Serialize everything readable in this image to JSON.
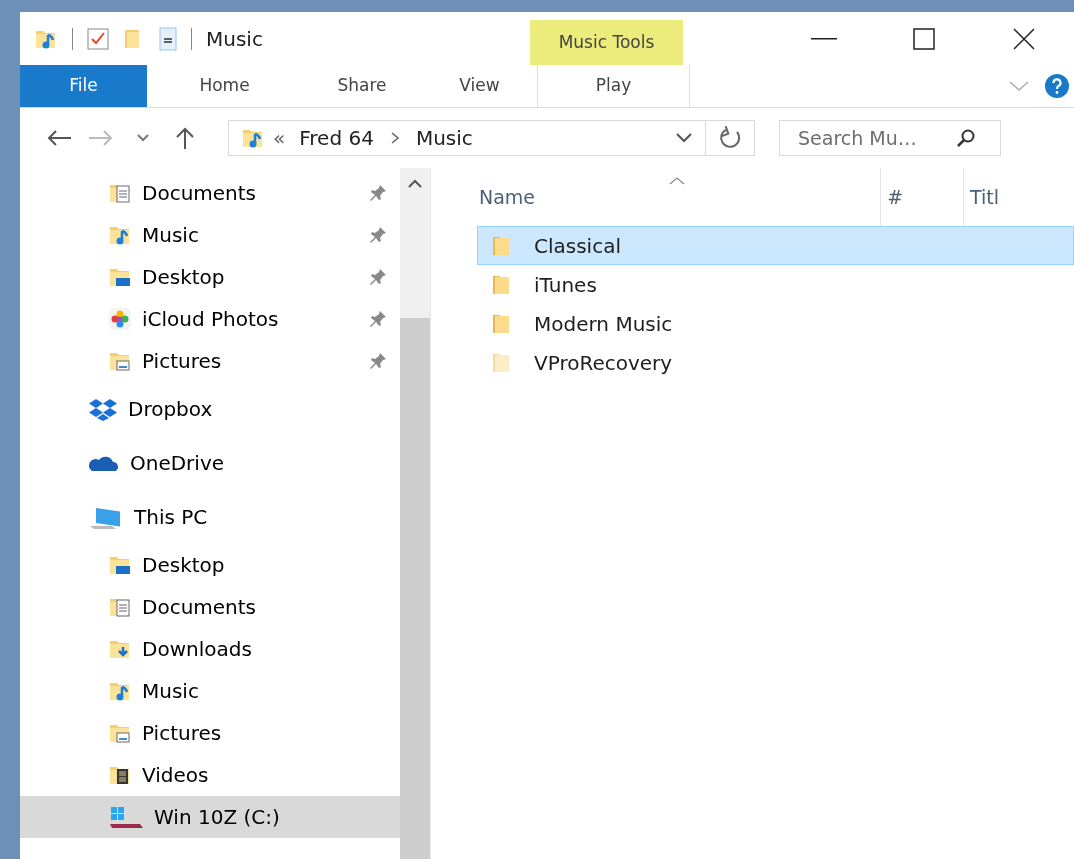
{
  "window": {
    "title": "Music"
  },
  "context_tab": {
    "label": "Music Tools"
  },
  "ribbon_tabs": [
    {
      "label": "File",
      "kind": "file",
      "selected": false
    },
    {
      "label": "Home",
      "kind": "tab",
      "selected": false
    },
    {
      "label": "Share",
      "kind": "tab",
      "selected": false
    },
    {
      "label": "View",
      "kind": "tab",
      "selected": false
    },
    {
      "label": "Play",
      "kind": "context",
      "selected": false
    }
  ],
  "address": {
    "overflow": "«",
    "segments": [
      "Fred 64",
      "Music"
    ]
  },
  "search": {
    "placeholder": "Search Mu…"
  },
  "nav": {
    "quick_access": [
      {
        "label": "Documents",
        "kind": "documents",
        "pinned": true,
        "selected": false
      },
      {
        "label": "Music",
        "kind": "music",
        "pinned": true,
        "selected": false
      },
      {
        "label": "Desktop",
        "kind": "desktop",
        "pinned": true,
        "selected": false
      },
      {
        "label": "iCloud Photos",
        "kind": "photos",
        "pinned": true,
        "selected": false
      },
      {
        "label": "Pictures",
        "kind": "pictures",
        "pinned": true,
        "selected": false
      }
    ],
    "items": [
      {
        "label": "Dropbox",
        "kind": "dropbox",
        "selected": false
      },
      {
        "label": "OneDrive",
        "kind": "onedrive",
        "selected": false
      },
      {
        "label": "This PC",
        "kind": "pc",
        "selected": false,
        "children": [
          {
            "label": "Desktop",
            "kind": "desktop",
            "selected": false
          },
          {
            "label": "Documents",
            "kind": "documents",
            "selected": false
          },
          {
            "label": "Downloads",
            "kind": "downloads",
            "selected": false
          },
          {
            "label": "Music",
            "kind": "music",
            "selected": false
          },
          {
            "label": "Pictures",
            "kind": "pictures",
            "selected": false
          },
          {
            "label": "Videos",
            "kind": "videos",
            "selected": false
          },
          {
            "label": "Win 10Z (C:)",
            "kind": "drive",
            "selected": true
          }
        ]
      }
    ]
  },
  "table": {
    "columns": [
      {
        "label": "Name",
        "sorted": true
      },
      {
        "label": "#",
        "sorted": false
      },
      {
        "label": "Titl",
        "sorted": false
      }
    ],
    "rows": [
      {
        "name": "Classical",
        "selected": true,
        "hidden": false
      },
      {
        "name": "iTunes",
        "selected": false,
        "hidden": false
      },
      {
        "name": "Modern Music",
        "selected": false,
        "hidden": false
      },
      {
        "name": "VProRecovery",
        "selected": false,
        "hidden": true
      }
    ]
  }
}
